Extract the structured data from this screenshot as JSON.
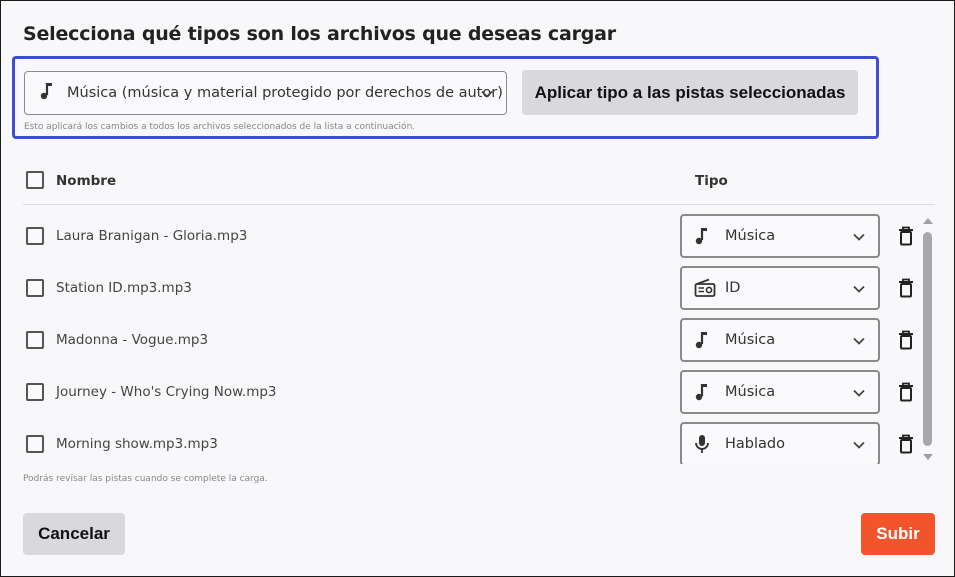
{
  "dialog": {
    "title": "Selecciona qué tipos son los archivos que deseas cargar"
  },
  "bulk": {
    "selected_type": "Música (música y material protegido por derechos de autor)",
    "selected_icon": "music-note-icon",
    "apply_label": "Aplicar tipo a las pistas seleccionadas",
    "hint": "Esto aplicará los cambios a todos los archivos seleccionados de la lista a continuación."
  },
  "table": {
    "headers": {
      "name": "Nombre",
      "type": "Tipo"
    },
    "rows": [
      {
        "filename": "Laura Branigan - Gloria.mp3",
        "type": "Música",
        "icon": "music-note-icon",
        "checked": false
      },
      {
        "filename": "Station ID.mp3.mp3",
        "type": "ID",
        "icon": "radio-icon",
        "checked": false
      },
      {
        "filename": "Madonna - Vogue.mp3",
        "type": "Música",
        "icon": "music-note-icon",
        "checked": false
      },
      {
        "filename": "Journey - Who's Crying Now.mp3",
        "type": "Música",
        "icon": "music-note-icon",
        "checked": false
      },
      {
        "filename": "Morning show.mp3.mp3",
        "type": "Hablado",
        "icon": "microphone-icon",
        "checked": false
      }
    ]
  },
  "footer": {
    "hint": "Podrás revisar las pistas cuando se complete la carga.",
    "cancel_label": "Cancelar",
    "submit_label": "Subir"
  },
  "colors": {
    "accent_border": "#3d4fd0",
    "submit": "#f2552c",
    "secondary_button": "#d8d8dd"
  }
}
